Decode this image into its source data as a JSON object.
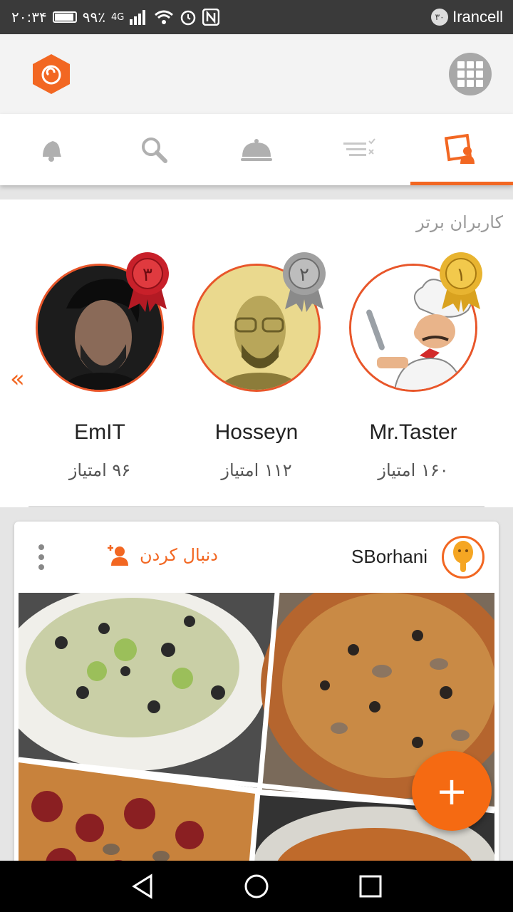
{
  "status_bar": {
    "time": "۲۰:۳۴",
    "battery": "۹۹٪",
    "network": "4G",
    "sim_badge": "۳۰",
    "carrier": "Irancell"
  },
  "tabs": [
    {
      "icon": "bell-icon",
      "active": false
    },
    {
      "icon": "search-icon",
      "active": false
    },
    {
      "icon": "cloche-icon",
      "active": false
    },
    {
      "icon": "filter-list-icon",
      "active": false
    },
    {
      "icon": "profile-card-icon",
      "active": true
    }
  ],
  "top_users": {
    "title": "کاربران برتر",
    "users": [
      {
        "rank": "۱",
        "name": "Mr.Taster",
        "points": "۱۶۰ امتیاز"
      },
      {
        "rank": "۲",
        "name": "Hosseyn",
        "points": "۱۱۲ امتیاز"
      },
      {
        "rank": "۳",
        "name": "EmIT",
        "points": "۹۶ امتیاز"
      }
    ]
  },
  "post": {
    "username": "SBorhani",
    "follow_label": "دنبال کردن"
  },
  "fab": {
    "label": "+"
  },
  "colors": {
    "accent": "#f26722",
    "gold": "#e8b430",
    "silver": "#a0a0a0",
    "bronze": "#c8202a"
  }
}
